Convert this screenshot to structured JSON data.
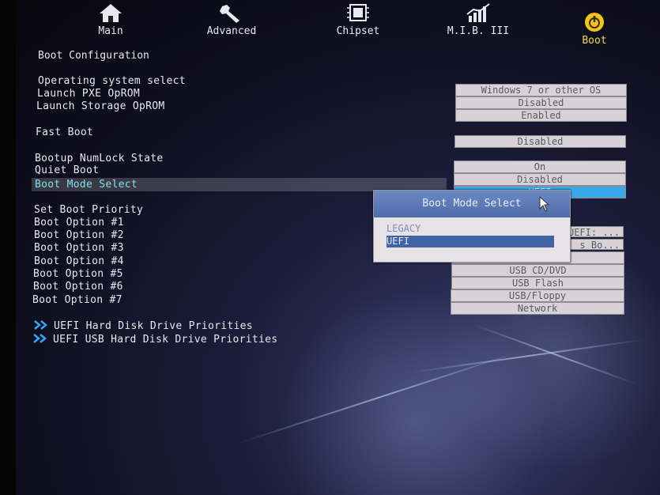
{
  "tabs": [
    {
      "label": "Main",
      "icon": "home-icon"
    },
    {
      "label": "Advanced",
      "icon": "wrench-icon"
    },
    {
      "label": "Chipset",
      "icon": "chip-icon"
    },
    {
      "label": "M.I.B. III",
      "icon": "chart-icon"
    },
    {
      "label": "Boot",
      "icon": "power-icon",
      "active": true
    }
  ],
  "section_title": "Boot Configuration",
  "settings": [
    {
      "label": "Operating system select",
      "value": "Windows 7 or other OS"
    },
    {
      "label": "Launch PXE OpROM",
      "value": "Disabled"
    },
    {
      "label": "Launch Storage OpROM",
      "value": "Enabled"
    },
    {
      "label": "Fast Boot",
      "value": "Disabled"
    },
    {
      "label": "Bootup NumLock State",
      "value": "On"
    },
    {
      "label": "Quiet Boot",
      "value": "Disabled"
    },
    {
      "label": "Boot Mode Select",
      "value": "UEFI"
    }
  ],
  "boot_priority": {
    "title": "Set Boot Priority",
    "options": [
      {
        "label": "Boot Option #1",
        "value": "UEFI: ..."
      },
      {
        "label": "Boot Option #2",
        "value": "s Bo..."
      },
      {
        "label": "Boot Option #3",
        "value": ""
      },
      {
        "label": "Boot Option #4",
        "value": "USB CD/DVD"
      },
      {
        "label": "Boot Option #5",
        "value": "USB Flash"
      },
      {
        "label": "Boot Option #6",
        "value": "USB/Floppy"
      },
      {
        "label": "Boot Option #7",
        "value": "Network"
      }
    ]
  },
  "submenus": [
    "UEFI Hard Disk Drive Priorities",
    "UEFI USB Hard Disk Drive Priorities"
  ],
  "popup": {
    "title": "Boot Mode Select",
    "options": [
      "LEGACY",
      "UEFI"
    ],
    "selected": "UEFI"
  },
  "colors": {
    "active_tab": "#f2d84a",
    "highlight_text": "#7fe0ef",
    "selected_value": "#3aa7e8",
    "popup_header": "#5a78b6"
  }
}
